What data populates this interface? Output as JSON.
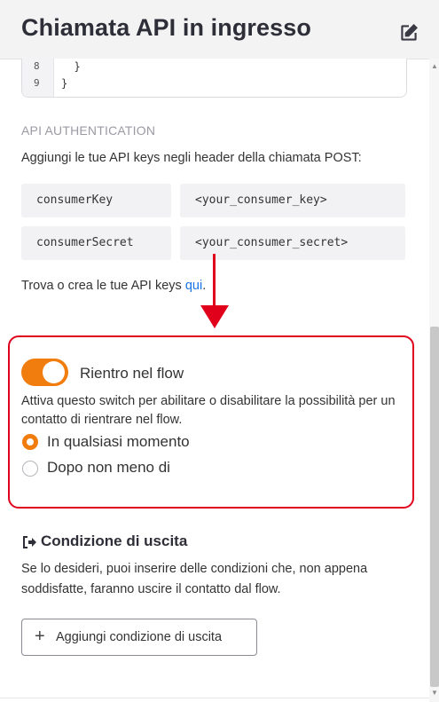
{
  "header": {
    "title": "Chiamata API in ingresso",
    "edit_icon": "edit-icon"
  },
  "code": {
    "lines": [
      {
        "num": "8",
        "text": "  }"
      },
      {
        "num": "9",
        "text": "}"
      }
    ]
  },
  "api_auth": {
    "section_label": "API AUTHENTICATION",
    "description": "Aggiungi le tue API keys negli header della chiamata POST:",
    "rows": [
      {
        "key": "consumerKey",
        "value": "<your_consumer_key>"
      },
      {
        "key": "consumerSecret",
        "value": "<your_consumer_secret>"
      }
    ],
    "link_prefix": "Trova o crea le tue API keys ",
    "link_text": "qui",
    "link_suffix": "."
  },
  "reentry": {
    "toggle_on": true,
    "label": "Rientro nel flow",
    "description": "Attiva questo switch per abilitare o disabilitare la possibilità per un contatto di rientrare nel flow.",
    "options": [
      {
        "label": "In qualsiasi momento",
        "selected": true
      },
      {
        "label": "Dopo non meno di",
        "selected": false
      }
    ]
  },
  "exit": {
    "title": "Condizione di uscita",
    "icon": "sign-out-icon",
    "description": "Se lo desideri, puoi inserire delle condizioni che, non appena soddisfatte, faranno uscire il contatto dal flow.",
    "button_label": "Aggiungi condizione di uscita"
  },
  "colors": {
    "accent": "#f07d0e",
    "annotation": "#e0001c",
    "link": "#1a73e8"
  }
}
